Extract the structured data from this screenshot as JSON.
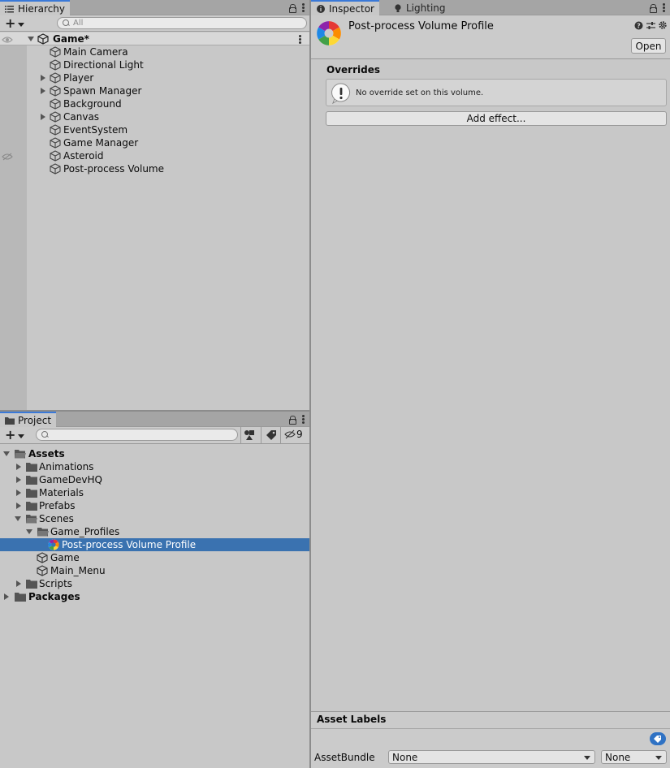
{
  "hierarchy": {
    "tab_label": "Hierarchy",
    "search_placeholder": "All",
    "scene_name": "Game*",
    "items": [
      {
        "label": "Main Camera",
        "expandable": false
      },
      {
        "label": "Directional Light",
        "expandable": false
      },
      {
        "label": "Player",
        "expandable": true
      },
      {
        "label": "Spawn Manager",
        "expandable": true
      },
      {
        "label": "Background",
        "expandable": false
      },
      {
        "label": "Canvas",
        "expandable": true
      },
      {
        "label": "EventSystem",
        "expandable": false
      },
      {
        "label": "Game Manager",
        "expandable": false
      },
      {
        "label": "Asteroid",
        "expandable": false
      },
      {
        "label": "Post-process Volume",
        "expandable": false
      }
    ]
  },
  "project": {
    "tab_label": "Project",
    "hidden_count": "9",
    "tree": {
      "assets": "Assets",
      "animations": "Animations",
      "gamedevhq": "GameDevHQ",
      "materials": "Materials",
      "prefabs": "Prefabs",
      "scenes": "Scenes",
      "game_profiles": "Game_Profiles",
      "selected_profile": "Post-process Volume Profile",
      "scene_game": "Game",
      "scene_main_menu": "Main_Menu",
      "scripts": "Scripts",
      "packages": "Packages"
    }
  },
  "inspector": {
    "tab_label": "Inspector",
    "lighting_tab_label": "Lighting",
    "title": "Post-process Volume Profile",
    "open_button": "Open",
    "overrides_label": "Overrides",
    "overrides_message": "No override set on this volume.",
    "add_effect_button": "Add effect...",
    "asset_labels_title": "Asset Labels",
    "assetbundle_label": "AssetBundle",
    "assetbundle_value": "None",
    "variant_value": "None"
  },
  "colors": {
    "selection": "#3a72b0",
    "tab_accent": "#3a79d8",
    "panel_bg": "#c8c8c8"
  }
}
